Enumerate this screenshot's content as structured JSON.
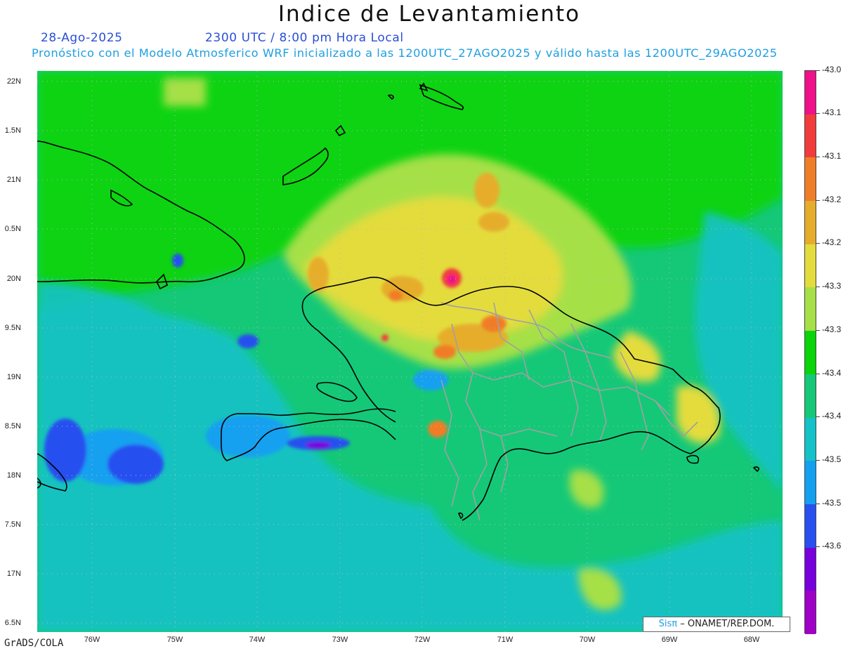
{
  "title": "Indice de Levantamiento",
  "date": "28-Ago-2025",
  "time": "2300 UTC / 8:00 pm Hora Local",
  "forecast": "Pronóstico con el Modelo Atmosferico WRF inicializado a las 1200UTC_27AGO2025 y válido hasta las  1200UTC_29AGO2025",
  "software": "GrADS/COLA",
  "credit": {
    "logo": "Sisπ",
    "text": "– ONAMET/REP.DOM."
  },
  "lat_labels": [
    "22N",
    "1.5N",
    "21N",
    "0.5N",
    "20N",
    "9.5N",
    "19N",
    "8.5N",
    "18N",
    "7.5N",
    "17N",
    "6.5N"
  ],
  "lon_labels": [
    "76W",
    "75W",
    "74W",
    "73W",
    "72W",
    "71W",
    "70W",
    "69W",
    "68W"
  ],
  "colorbar": {
    "labels": [
      "-43.0",
      "-43.1",
      "-43.1",
      "-43.2",
      "-43.2",
      "-43.3",
      "-43.3",
      "-43.4",
      "-43.4",
      "-43.5",
      "-43.5",
      "-43.6"
    ],
    "colors": [
      "#f0108a",
      "#f23c3c",
      "#f07d28",
      "#e6ad2c",
      "#e4dc3c",
      "#a6e046",
      "#0ad40a",
      "#14c878",
      "#14c2c8",
      "#14a0f0",
      "#2850f0",
      "#7800dc",
      "#a000c8"
    ]
  }
}
